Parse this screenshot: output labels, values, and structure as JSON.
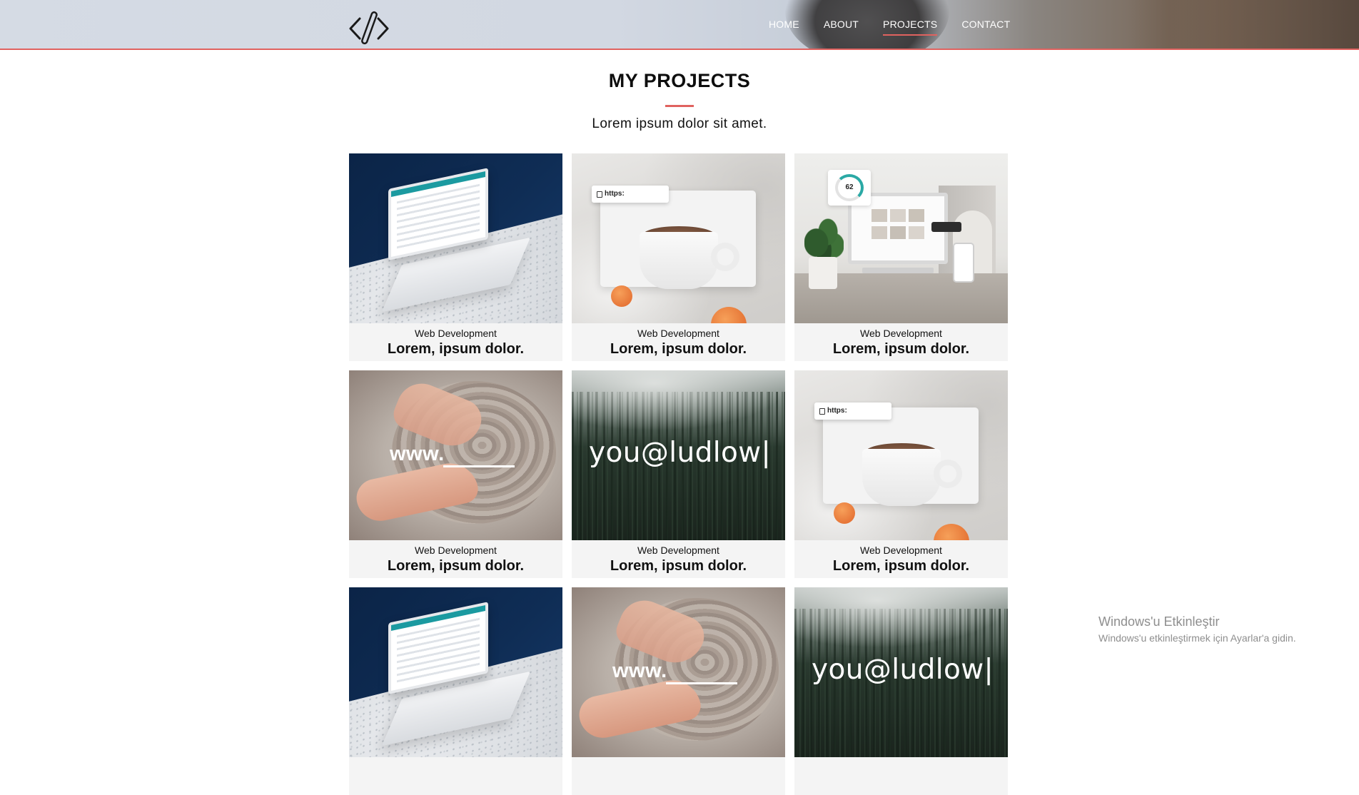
{
  "header": {
    "logo_icon": "code-brackets-icon",
    "nav": [
      {
        "label": "HOME",
        "active": false
      },
      {
        "label": "ABOUT",
        "active": false
      },
      {
        "label": "PROJECTS",
        "active": true
      },
      {
        "label": "CONTACT",
        "active": false
      }
    ]
  },
  "projects_section": {
    "title": "MY PROJECTS",
    "subtitle": "Lorem ipsum dolor sit amet."
  },
  "projects": [
    {
      "category": "Web Development",
      "title": "Lorem, ipsum dolor.",
      "image": "laptop-desk"
    },
    {
      "category": "Web Development",
      "title": "Lorem, ipsum dolor.",
      "image": "coffee-cup-browser",
      "image_text": "https:"
    },
    {
      "category": "Web Development",
      "title": "Lorem, ipsum dolor.",
      "image": "devices-setup",
      "image_text": "62"
    },
    {
      "category": "Web Development",
      "title": "Lorem, ipsum dolor.",
      "image": "pottery-hands",
      "image_text": "www."
    },
    {
      "category": "Web Development",
      "title": "Lorem, ipsum dolor.",
      "image": "misty-forest",
      "image_text": "you@ludlow|"
    },
    {
      "category": "Web Development",
      "title": "Lorem, ipsum dolor.",
      "image": "coffee-cup-browser",
      "image_text": "https:"
    },
    {
      "category": "",
      "title": "",
      "image": "laptop-desk"
    },
    {
      "category": "",
      "title": "",
      "image": "pottery-hands",
      "image_text": "www."
    },
    {
      "category": "",
      "title": "",
      "image": "misty-forest",
      "image_text": "you@ludlow|"
    }
  ],
  "watermark": {
    "title": "Windows'u Etkinleştir",
    "subtitle": "Windows'u etkinleştirmek için Ayarlar'a gidin."
  },
  "colors": {
    "accent": "#e0625f",
    "card_background": "#f4f4f4",
    "text": "#111111"
  }
}
